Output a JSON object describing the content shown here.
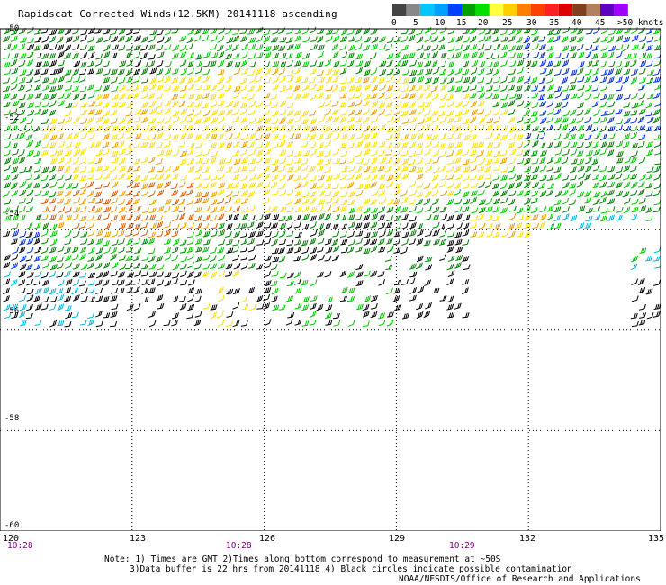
{
  "title": "Rapidscat Corrected Winds(12.5KM) 20141118 ascending",
  "legend": {
    "colors": [
      "#444444",
      "#888888",
      "#00c8ff",
      "#00a0ff",
      "#0040ff",
      "#00a000",
      "#00e000",
      "#ffff40",
      "#ffd000",
      "#ff8000",
      "#ff4000",
      "#ff2020",
      "#e00000",
      "#804020",
      "#b08060",
      "#6000c0",
      "#a000ff"
    ],
    "labels": [
      "0",
      "5",
      "10",
      "15",
      "20",
      "25",
      "30",
      "35",
      "40",
      "45",
      ">50 knots"
    ]
  },
  "axes": {
    "lat_labels": [
      "-50",
      "-52",
      "-54",
      "-56",
      "-58",
      "-60"
    ],
    "lon_labels": [
      "120",
      "123",
      "126",
      "129",
      "132",
      "135"
    ]
  },
  "times": [
    "10:28",
    "10:28",
    "10:29"
  ],
  "notes": {
    "line1": "Note: 1) Times are GMT 2)Times along bottom correspond to measurement at ~50S",
    "line2": "3)Data buffer is 22 hrs from 20141118 4) Black circles indicate possible contamination",
    "line3": "NOAA/NESDIS/Office of Research and Applications"
  },
  "map": {
    "lat_range": [
      -60,
      -50
    ],
    "lon_range": [
      120,
      135
    ],
    "grid": "dotted",
    "barb_colors": {
      "black": "#000000",
      "blue": "#0030e0",
      "cyan": "#00b8e0",
      "dark-green": "#008000",
      "green": "#00c800",
      "yellow": "#ffe000",
      "orange": "#f0a000",
      "red-orange": "#e05a00"
    }
  }
}
